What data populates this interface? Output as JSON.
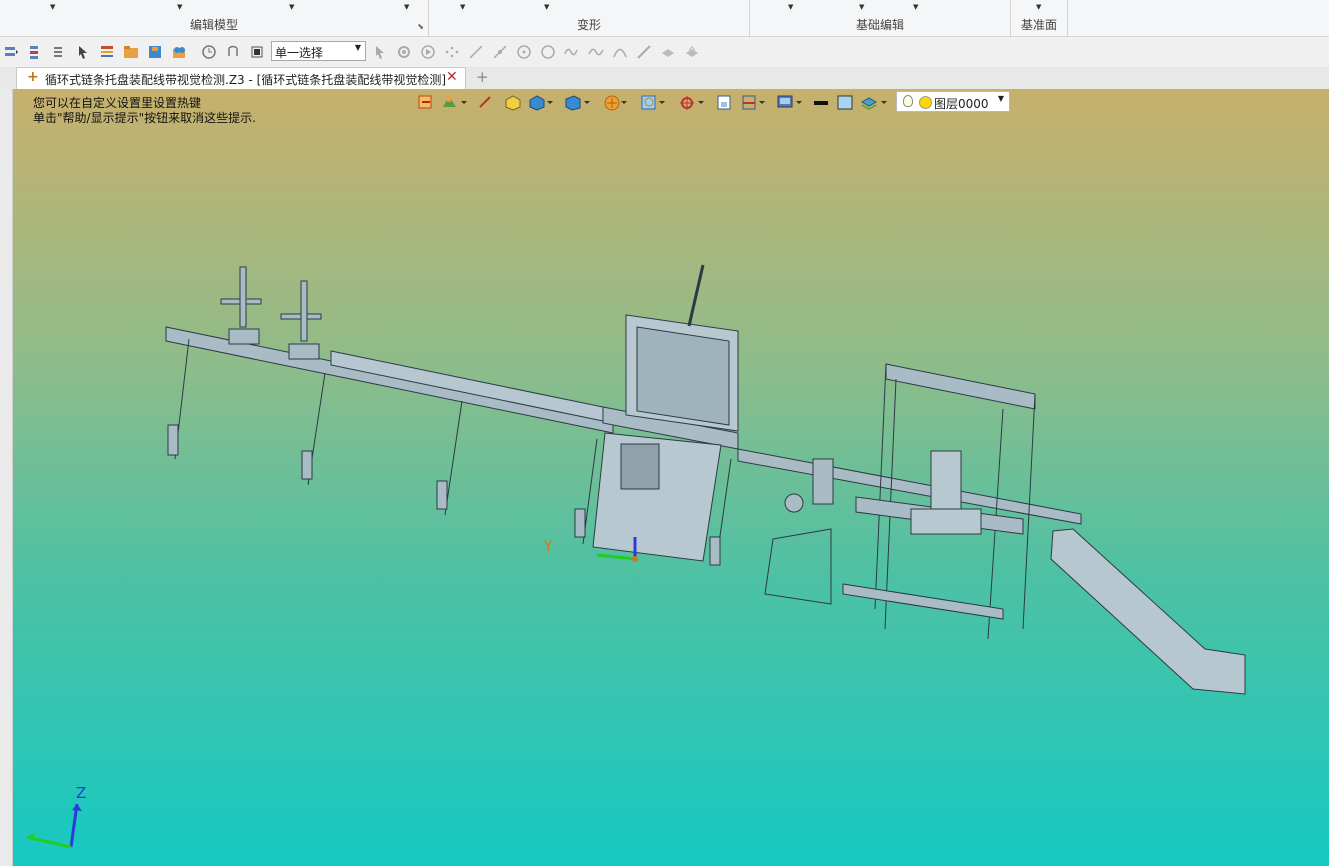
{
  "ribbon": {
    "groups": [
      {
        "label": "编辑模型"
      },
      {
        "label": "变形"
      },
      {
        "label": "基础编辑"
      },
      {
        "label": "基准面"
      }
    ]
  },
  "toolbar": {
    "selection_mode": "单一选择"
  },
  "tabs": {
    "active_title": "循环式链条托盘装配线带视觉检测.Z3 - [循环式链条托盘装配线带视觉检测]",
    "close_glyph": "✕",
    "new_tab_glyph": "+"
  },
  "viewport": {
    "hint_line1": "您可以在自定义设置里设置热键",
    "hint_line2": "单击\"帮助/显示提示\"按钮来取消这些提示.",
    "layer_name": "图层0000",
    "axis_y_label": "Y",
    "axis_z_label": "Z"
  },
  "colors": {
    "bg_top": "#c7b06c",
    "bg_bottom": "#15c9c2",
    "model_fill": "#9fb3bd",
    "model_stroke": "#2c3a44",
    "axis_x": "#22cc22",
    "axis_y": "#d07a10",
    "axis_z": "#2a3cd8"
  },
  "icons": {
    "toolbar": [
      "select-icon",
      "filter-icon",
      "pick-icon",
      "cursor-icon",
      "list-icon",
      "folder-icon",
      "save-icon",
      "export-icon",
      "clock-icon",
      "undo-icon",
      "stop-icon"
    ],
    "disabled": [
      "arrow-select-icon",
      "gear-icon",
      "play-icon",
      "scatter-icon",
      "line-icon",
      "slash-icon",
      "circle-dot-icon",
      "circle-icon",
      "wave-icon",
      "curve-icon",
      "arc-icon",
      "pen-icon",
      "hand-icon",
      "shape-icon"
    ]
  }
}
